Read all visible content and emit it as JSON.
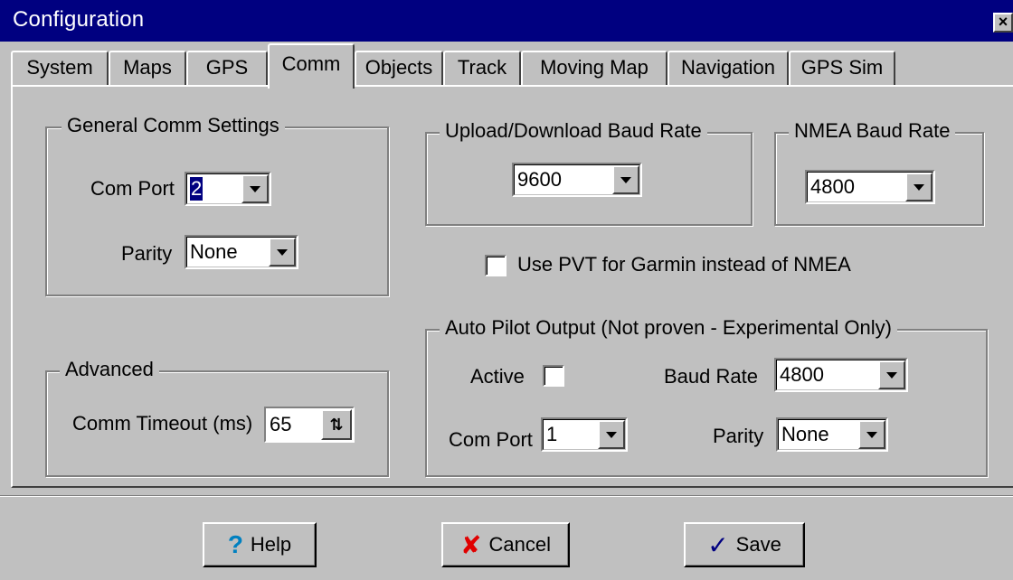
{
  "window": {
    "title": "Configuration"
  },
  "tabs": [
    {
      "label": "System"
    },
    {
      "label": "Maps"
    },
    {
      "label": "GPS"
    },
    {
      "label": "Comm",
      "active": true
    },
    {
      "label": "Objects"
    },
    {
      "label": "Track"
    },
    {
      "label": "Moving Map"
    },
    {
      "label": "Navigation"
    },
    {
      "label": "GPS Sim"
    }
  ],
  "general": {
    "legend": "General Comm Settings",
    "com_port_label": "Com Port",
    "com_port_value": "2",
    "parity_label": "Parity",
    "parity_value": "None"
  },
  "upload": {
    "legend": "Upload/Download Baud Rate",
    "value": "9600"
  },
  "nmea": {
    "legend": "NMEA Baud Rate",
    "value": "4800"
  },
  "pvt": {
    "label": "Use PVT for Garmin instead of NMEA",
    "checked": false
  },
  "advanced": {
    "legend": "Advanced",
    "timeout_label": "Comm Timeout (ms)",
    "timeout_value": "65"
  },
  "autopilot": {
    "legend": "Auto Pilot Output  (Not proven - Experimental Only)",
    "active_label": "Active",
    "active_checked": false,
    "baud_label": "Baud Rate",
    "baud_value": "4800",
    "com_port_label": "Com Port",
    "com_port_value": "1",
    "parity_label": "Parity",
    "parity_value": "None"
  },
  "buttons": {
    "help": "Help",
    "cancel": "Cancel",
    "save": "Save"
  },
  "icons": {
    "help": "question-icon",
    "cancel": "x-icon",
    "save": "save-check-icon",
    "close": "close-icon"
  },
  "colors": {
    "titlebar": "#000080",
    "face": "#c0c0c0",
    "help_icon": "#0080c0",
    "cancel_icon": "#e00000"
  }
}
